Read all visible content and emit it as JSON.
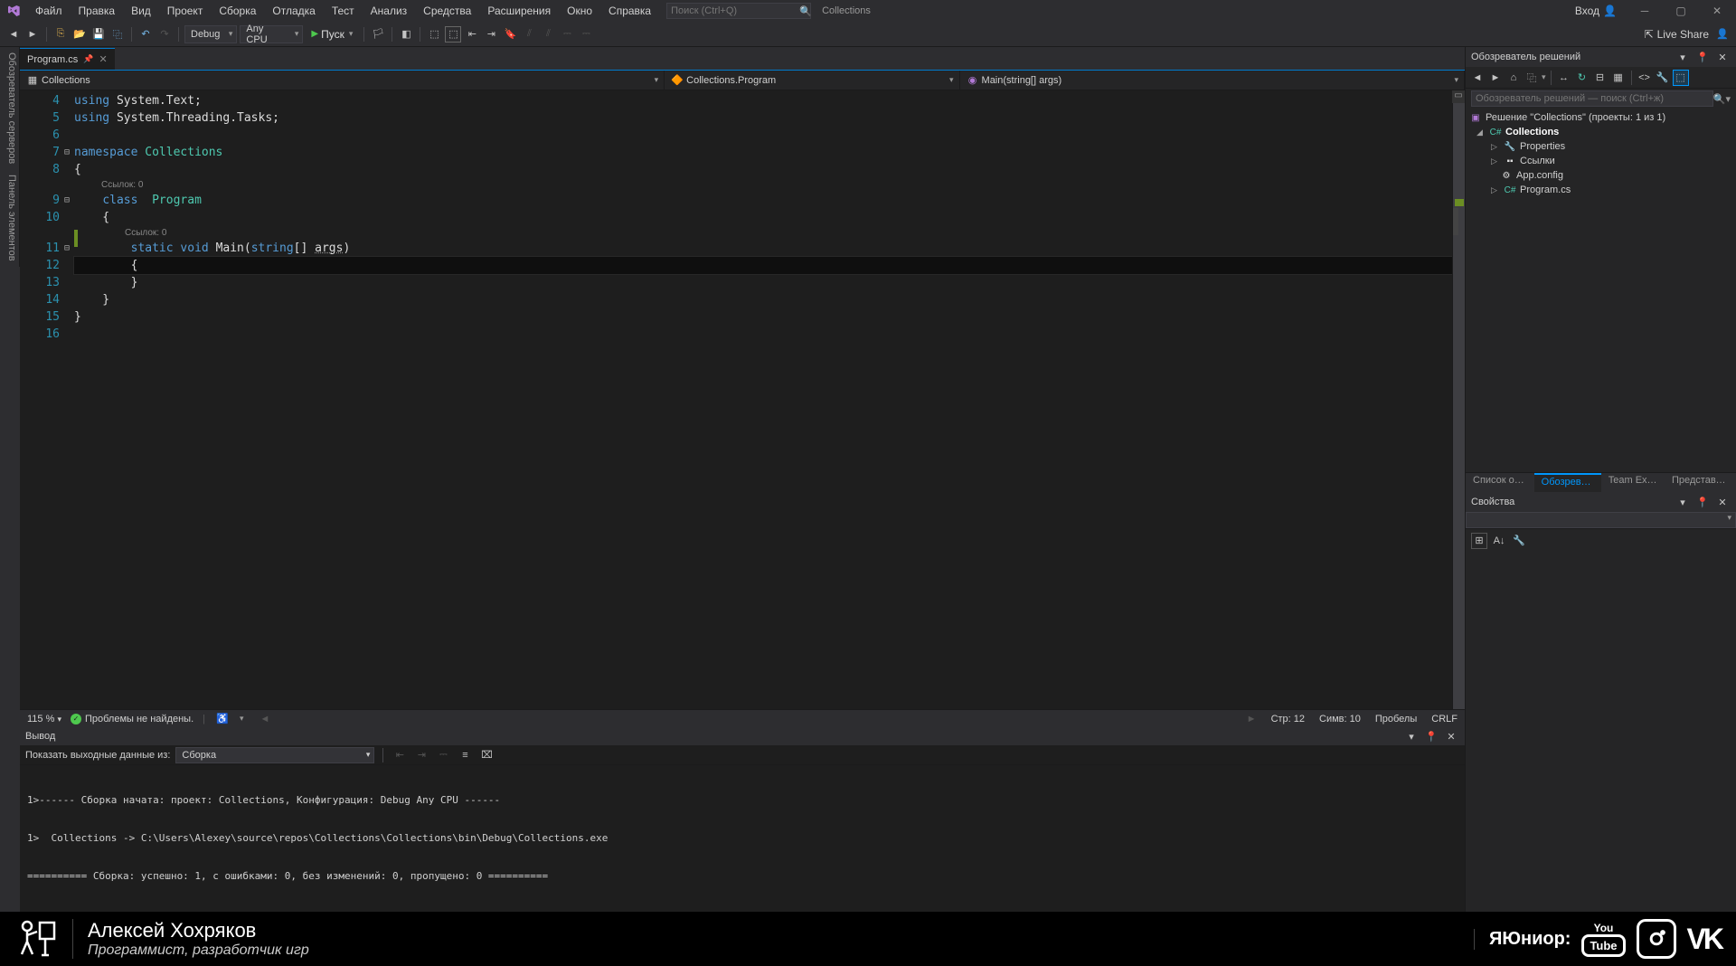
{
  "menu": [
    "Файл",
    "Правка",
    "Вид",
    "Проект",
    "Сборка",
    "Отладка",
    "Тест",
    "Анализ",
    "Средства",
    "Расширения",
    "Окно",
    "Справка"
  ],
  "searchPlaceholder": "Поиск (Ctrl+Q)",
  "solutionTitle": "Collections",
  "signIn": "Вход",
  "toolbar": {
    "config": "Debug",
    "platform": "Any CPU",
    "run": "Пуск",
    "liveShare": "Live Share"
  },
  "vtabs": [
    "Обозреватель серверов",
    "Панель элементов"
  ],
  "tab": {
    "file": "Program.cs"
  },
  "nav": {
    "project": "Collections",
    "class": "Collections.Program",
    "method": "Main(string[] args)"
  },
  "code": {
    "refs0": "Ссылок: 0",
    "l4a": "using",
    "l4b": " System.Text;",
    "l5a": "using",
    "l5b": " System.Threading.Tasks;",
    "l7a": "namespace",
    "l7b": " Collections",
    "l9a": "class",
    "l9b": " Program",
    "l11a": "static",
    "l11b": "void",
    "l11c": "Main",
    "l11d": "string",
    "l11e": "args"
  },
  "lineNums": [
    "4",
    "5",
    "6",
    "7",
    "8",
    "",
    "9",
    "10",
    "",
    "11",
    "12",
    "13",
    "14",
    "15",
    "16"
  ],
  "status": {
    "zoom": "115 %",
    "problems": "Проблемы не найдены.",
    "line": "Стр: 12",
    "col": "Симв: 10",
    "spaces": "Пробелы",
    "crlf": "CRLF"
  },
  "solutionExplorer": {
    "title": "Обозреватель решений",
    "searchPlaceholder": "Обозреватель решений — поиск (Ctrl+ж)",
    "root": "Решение \"Collections\" (проекты: 1 из 1)",
    "project": "Collections",
    "items": [
      "Properties",
      "Ссылки",
      "App.config",
      "Program.cs"
    ]
  },
  "bottomTabs": [
    "Список ошибок",
    "Обозревател...",
    "Team Explorer",
    "Представлени..."
  ],
  "properties": {
    "title": "Свойства"
  },
  "output": {
    "title": "Вывод",
    "showFromLabel": "Показать выходные данные из:",
    "showFrom": "Сборка",
    "lines": [
      "1>------ Сборка начата: проект: Collections, Конфигурация: Debug Any CPU ------",
      "1>  Collections -> C:\\Users\\Alexey\\source\\repos\\Collections\\Collections\\bin\\Debug\\Collections.exe",
      "========== Сборка: успешно: 1, с ошибками: 0, без изменений: 0, пропущено: 0 =========="
    ]
  },
  "footer": {
    "name": "Алексей Хохряков",
    "sub": "Программист, разработчик игр",
    "brand": "ЯЮниор:"
  }
}
